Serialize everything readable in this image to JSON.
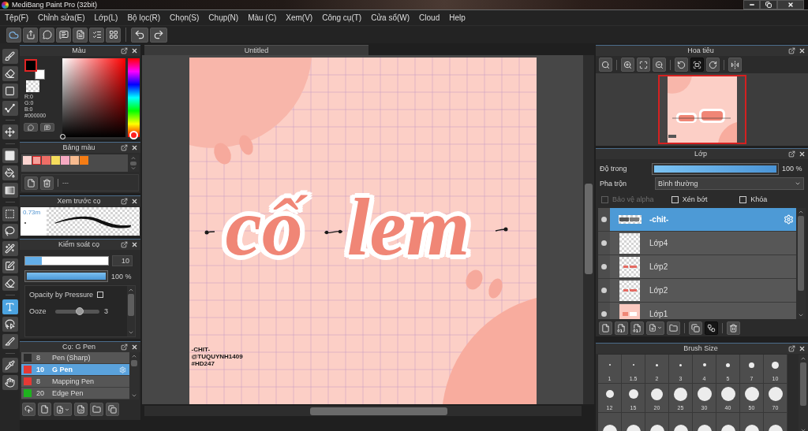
{
  "window": {
    "title": "MediBang Paint Pro (32bit)"
  },
  "menu": [
    "Tệp(F)",
    "Chỉnh sửa(E)",
    "Lớp(L)",
    "Bộ lọc(R)",
    "Chọn(S)",
    "Chụp(N)",
    "Màu (C)",
    "Xem(V)",
    "Công cụ(T)",
    "Cửa sổ(W)",
    "Cloud",
    "Help"
  ],
  "tools": [
    {
      "selected": false
    },
    {
      "selected": false
    },
    {
      "selected": false
    },
    {
      "selected": false
    },
    {
      "selected": false
    },
    {
      "selected": false
    },
    {
      "selected": false
    },
    {
      "selected": false
    },
    {
      "selected": false
    },
    {
      "selected": false
    },
    {
      "selected": false
    },
    {
      "selected": false
    },
    {
      "selected": false
    },
    {
      "selected": true
    },
    {
      "selected": false
    },
    {
      "selected": false
    },
    {
      "selected": false
    },
    {
      "selected": false
    }
  ],
  "color_panel": {
    "title": "Màu",
    "swatches": [
      {
        "color": "#000000",
        "selected": true
      },
      {
        "color": "#ffffff",
        "selected": false
      }
    ],
    "readout": [
      "R:0",
      "G:0",
      "B:0",
      "#000000"
    ]
  },
  "palette_panel": {
    "title": "Bảng màu",
    "colors": [
      {
        "color": "#fbd4d0",
        "selected": false
      },
      {
        "color": "#f5a09a",
        "selected": true
      },
      {
        "color": "#ee6e66",
        "selected": false
      },
      {
        "color": "#f6dc5c",
        "selected": false
      },
      {
        "color": "#f6a9c2",
        "selected": false
      },
      {
        "color": "#f8bb8f",
        "selected": false
      },
      {
        "color": "#f57c14",
        "selected": false
      }
    ],
    "name": "---"
  },
  "brush_preview": {
    "title": "Xem trước cọ",
    "size": "0.73m"
  },
  "brush_control": {
    "title": "Kiểm soát cọ",
    "size": {
      "level": 0.2,
      "value": "10"
    },
    "opacity": {
      "level": 1,
      "value": "100 %"
    },
    "opacity_by_pressure": {
      "label": "Opacity by Pressure",
      "checked": false
    },
    "ooze": {
      "label": "Ooze",
      "level": 0.55,
      "value": "3"
    }
  },
  "brush_list": {
    "title": "Cọ: G Pen",
    "items": [
      {
        "color": "#2b2b2b",
        "size": "8",
        "name": "Pen (Sharp)",
        "selected": false
      },
      {
        "color": "#e53935",
        "size": "10",
        "name": "G Pen",
        "selected": true
      },
      {
        "color": "#e53935",
        "size": "8",
        "name": "Mapping Pen",
        "selected": false
      },
      {
        "color": "#1fb31f",
        "size": "20",
        "name": "Edge Pen",
        "selected": false
      }
    ]
  },
  "canvas": {
    "tab": "Untitled",
    "lettering": [
      "cố",
      "lem"
    ],
    "credits": [
      "-CHIT-",
      "@TUQUYNH1409",
      "#HD247"
    ]
  },
  "navigator": {
    "title": "Hoa tiêu",
    "tools": [
      {
        "selected": false
      },
      {
        "selected": false
      },
      {
        "selected": false
      },
      {
        "selected": false
      },
      {
        "selected": false
      },
      {
        "selected": true
      },
      {
        "selected": false
      },
      {
        "selected": false
      }
    ]
  },
  "layers_panel": {
    "title": "Lớp",
    "opacity": {
      "label": "Độ trong",
      "level": 1,
      "value": "100 %"
    },
    "blend": {
      "label": "Pha trộn",
      "value": "Bình thường"
    },
    "options": [
      {
        "label": "Bảo vệ alpha",
        "checked": false,
        "disabled": true
      },
      {
        "label": "Xén bớt",
        "checked": false,
        "disabled": false
      },
      {
        "label": "Khóa",
        "checked": false,
        "disabled": false
      }
    ],
    "layers": [
      {
        "name": "-chit-",
        "selected": true,
        "visible": true
      },
      {
        "name": "Lớp4",
        "selected": false,
        "visible": true
      },
      {
        "name": "Lớp2",
        "selected": false,
        "visible": true
      },
      {
        "name": "Lớp2",
        "selected": false,
        "visible": true
      },
      {
        "name": "Lớp1",
        "selected": false,
        "visible": true
      }
    ],
    "tools": [
      {
        "selected": false
      },
      {
        "selected": false
      },
      {
        "selected": false
      },
      {
        "selected": false
      },
      {
        "selected": false
      },
      {
        "selected": false
      },
      {
        "selected": true
      },
      {
        "selected": false
      }
    ]
  },
  "brush_size": {
    "title": "Brush Size",
    "sizes": [
      "1",
      "1.5",
      "2",
      "3",
      "4",
      "5",
      "7",
      "10",
      "12",
      "15",
      "20",
      "25",
      "30",
      "40",
      "50",
      "70"
    ]
  }
}
